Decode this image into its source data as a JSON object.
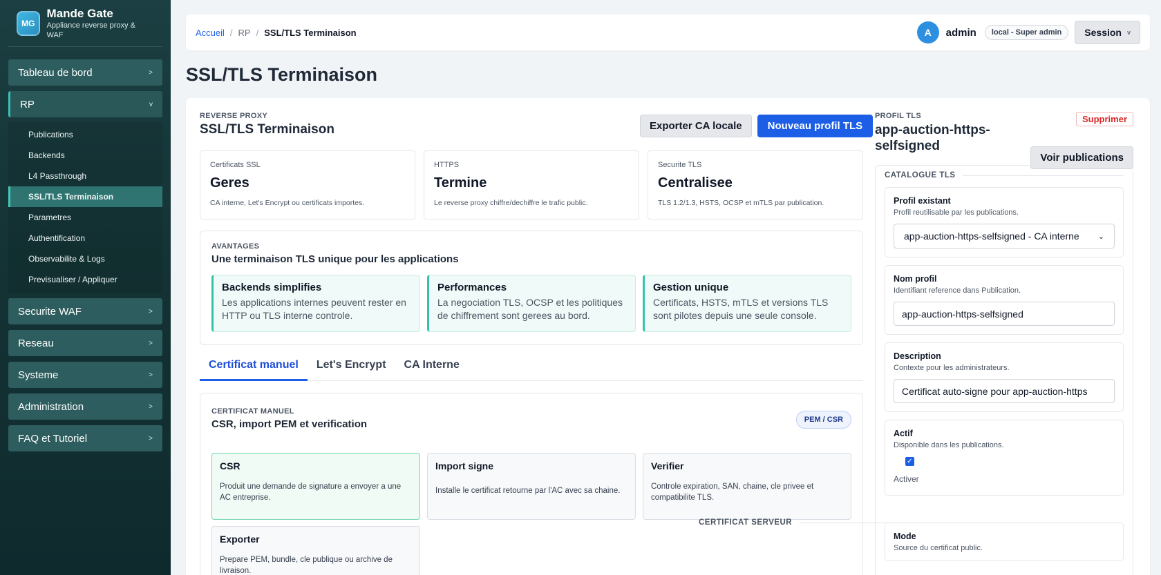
{
  "brand": {
    "logo": "MG",
    "title": "Mande Gate",
    "subtitle": "Appliance reverse proxy & WAF"
  },
  "nav": {
    "items": [
      {
        "label": "Tableau de bord",
        "chevron": ">"
      },
      {
        "label": "RP",
        "chevron": "v"
      },
      {
        "label": "Securite WAF",
        "chevron": ">"
      },
      {
        "label": "Reseau",
        "chevron": ">"
      },
      {
        "label": "Systeme",
        "chevron": ">"
      },
      {
        "label": "Administration",
        "chevron": ">"
      },
      {
        "label": "FAQ et Tutoriel",
        "chevron": ">"
      }
    ],
    "rp_sub": [
      "Publications",
      "Backends",
      "L4 Passthrough",
      "SSL/TLS Terminaison",
      "Parametres",
      "Authentification",
      "Observabilite & Logs",
      "Previsualiser / Appliquer"
    ]
  },
  "breadcrumb": {
    "home": "Accueil",
    "sep": "/",
    "section": "RP",
    "current": "SSL/TLS Terminaison"
  },
  "user": {
    "initial": "A",
    "name": "admin",
    "role": "local - Super admin",
    "session": "Session",
    "session_chev": "v"
  },
  "page_title": "SSL/TLS Terminaison",
  "section": {
    "eyebrow": "REVERSE PROXY",
    "title": "SSL/TLS Terminaison",
    "export_label": "Exporter CA locale",
    "new_label": "Nouveau profil TLS"
  },
  "stats": [
    {
      "label": "Certificats SSL",
      "value": "Geres",
      "desc": "CA interne, Let's Encrypt ou certificats importes."
    },
    {
      "label": "HTTPS",
      "value": "Termine",
      "desc": "Le reverse proxy chiffre/dechiffre le trafic public."
    },
    {
      "label": "Securite TLS",
      "value": "Centralisee",
      "desc": "TLS 1.2/1.3, HSTS, OCSP et mTLS par publication."
    }
  ],
  "advantages": {
    "eyebrow": "AVANTAGES",
    "title": "Une terminaison TLS unique pour les applications",
    "cards": [
      {
        "title": "Backends simplifies",
        "text": "Les applications internes peuvent rester en HTTP ou TLS interne controle."
      },
      {
        "title": "Performances",
        "text": "La negociation TLS, OCSP et les politiques de chiffrement sont gerees au bord."
      },
      {
        "title": "Gestion unique",
        "text": "Certificats, HSTS, mTLS et versions TLS sont pilotes depuis une seule console."
      }
    ]
  },
  "tabs": [
    "Certificat manuel",
    "Let's Encrypt",
    "CA Interne"
  ],
  "manual": {
    "eyebrow": "CERTIFICAT MANUEL",
    "title": "CSR, import PEM et verification",
    "pill": "PEM / CSR",
    "steps": [
      {
        "title": "CSR",
        "text": "Produit une demande de signature a envoyer a une AC entreprise."
      },
      {
        "title": "Import signe",
        "text": "Installe le certificat retourne par l'AC avec sa chaine."
      },
      {
        "title": "Verifier",
        "text": "Controle expiration, SAN, chaine, cle privee et compatibilite TLS."
      },
      {
        "title": "Exporter",
        "text": "Prepare PEM, bundle, cle publique ou archive de livraison."
      }
    ]
  },
  "profile": {
    "eyebrow": "PROFIL TLS",
    "title": "app-auction-https-selfsigned",
    "delete_label": "Supprimer",
    "publications_label": "Voir publications",
    "catalogue_label": "CATALOGUE TLS",
    "existing": {
      "label": "Profil existant",
      "help": "Profil reutilisable par les publications.",
      "value": "app-auction-https-selfsigned - CA interne"
    },
    "name": {
      "label": "Nom profil",
      "help": "Identifiant reference dans Publication.",
      "value": "app-auction-https-selfsigned"
    },
    "description": {
      "label": "Description",
      "help": "Contexte pour les administrateurs.",
      "value": "Certificat auto-signe pour app-auction-https"
    },
    "active": {
      "label": "Actif",
      "help": "Disponible dans les publications.",
      "check_label": "Activer",
      "checked": true
    },
    "cert_label": "CERTIFICAT SERVEUR",
    "mode": {
      "label": "Mode",
      "help": "Source du certificat public."
    }
  },
  "colors": {
    "accent": "#1d5ee6",
    "sidebar": "#143335",
    "danger": "#dc2626",
    "teal": "#35c2a8"
  }
}
